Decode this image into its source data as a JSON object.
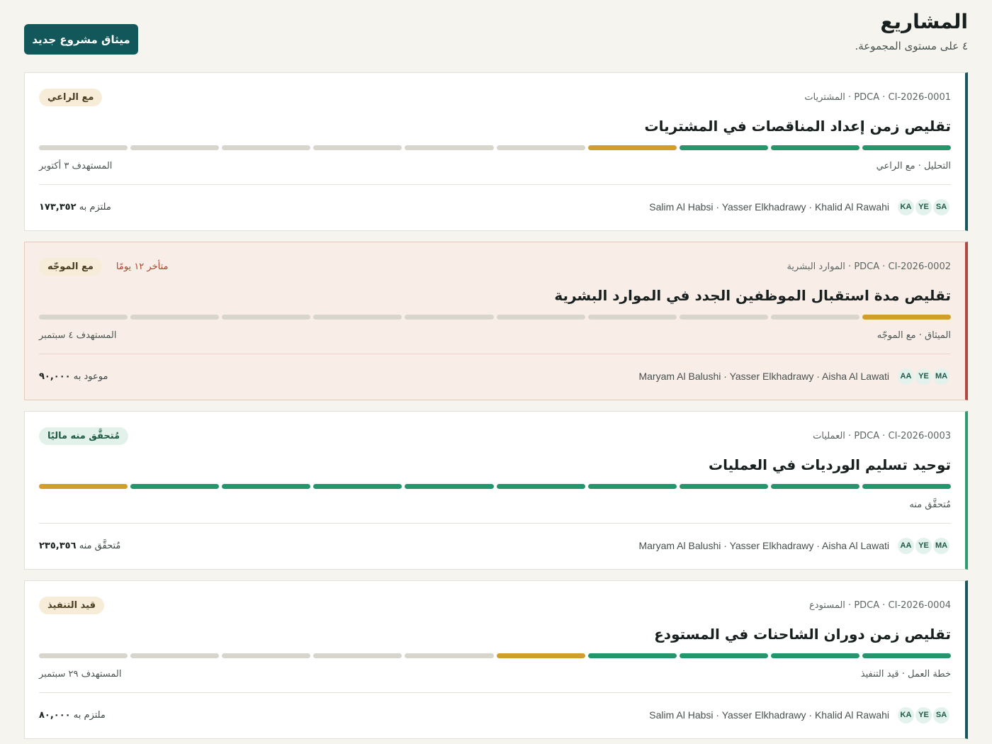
{
  "header": {
    "title": "المشاريع",
    "subtitle": "٤ على مستوى المجموعة.",
    "new_button": "ميثاق مشروع جديد"
  },
  "colors": {
    "primary": "#12585b",
    "done": "#24966c",
    "current": "#d39d2b",
    "pending": "#d8d5cc",
    "overdue_accent": "#b0483f"
  },
  "projects": [
    {
      "meta": "PDCA · CI-2026-0001 · المشتريات",
      "title": "تقليص زمن إعداد المناقصات في المشتريات",
      "status_pill": "مع الراعي",
      "overdue_text": "",
      "stage": "التحليل · مع الراعي",
      "target": "المستهدف ٣ أكتوبر",
      "progress_total": 10,
      "progress_done": 3,
      "progress_current": 4,
      "team": "Salim Al Habsi · Yasser Elkhadrawy · Khalid Al Rawahi",
      "initials": [
        "KA",
        "YE",
        "SA"
      ],
      "amount_label": "ملتزم به",
      "amount_value": "١٧٣,٣٥٢"
    },
    {
      "meta": "PDCA · CI-2026-0002 · الموارد البشرية",
      "title": "تقليص مدة استقبال الموظفين الجدد في الموارد البشرية",
      "status_pill": "مع الموجّه",
      "overdue_text": "متأخر ١٢ يومًا",
      "stage": "الميثاق · مع الموجّه",
      "target": "المستهدف ٤ سبتمبر",
      "progress_total": 10,
      "progress_done": 0,
      "progress_current": 1,
      "team": "Maryam Al Balushi · Yasser Elkhadrawy · Aisha Al Lawati",
      "initials": [
        "AA",
        "YE",
        "MA"
      ],
      "amount_label": "موعود به",
      "amount_value": "٩٠,٠٠٠"
    },
    {
      "meta": "PDCA · CI-2026-0003 · العمليات",
      "title": "توحيد تسليم الورديات في العمليات",
      "status_pill": "مُتحقَّق منه ماليًا",
      "overdue_text": "",
      "stage": "مُتحقَّق منه",
      "target": "",
      "progress_total": 10,
      "progress_done": 9,
      "progress_current": 10,
      "team": "Maryam Al Balushi · Yasser Elkhadrawy · Aisha Al Lawati",
      "initials": [
        "AA",
        "YE",
        "MA"
      ],
      "amount_label": "مُتحقَّق منه",
      "amount_value": "٢٣٥,٣٥٦"
    },
    {
      "meta": "PDCA · CI-2026-0004 · المستودع",
      "title": "تقليص زمن دوران الشاحنات في المستودع",
      "status_pill": "قيد التنفيذ",
      "overdue_text": "",
      "stage": "خطة العمل · قيد التنفيذ",
      "target": "المستهدف ٢٩ سبتمبر",
      "progress_total": 10,
      "progress_done": 4,
      "progress_current": 5,
      "team": "Salim Al Habsi · Yasser Elkhadrawy · Khalid Al Rawahi",
      "initials": [
        "KA",
        "YE",
        "SA"
      ],
      "amount_label": "ملتزم به",
      "amount_value": "٨٠,٠٠٠"
    }
  ]
}
